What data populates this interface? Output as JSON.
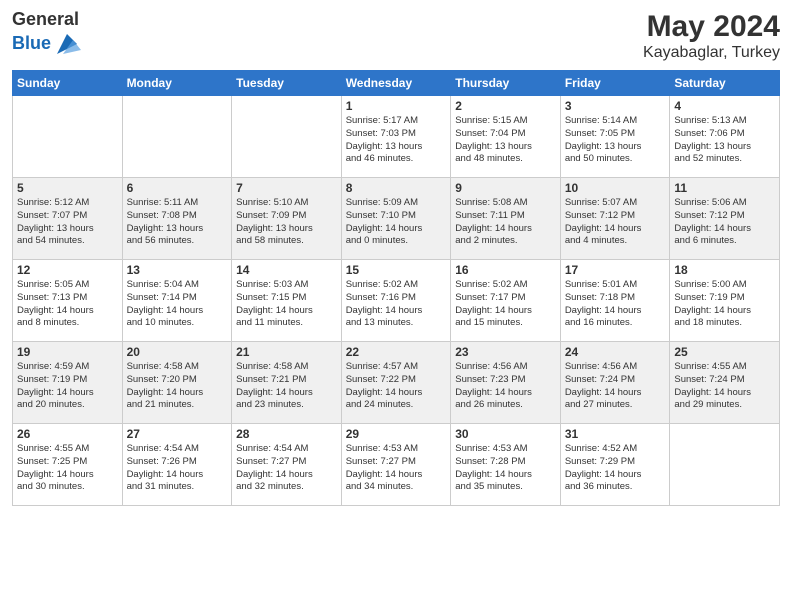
{
  "header": {
    "logo_general": "General",
    "logo_blue": "Blue",
    "month_year": "May 2024",
    "location": "Kayabaglar, Turkey"
  },
  "weekdays": [
    "Sunday",
    "Monday",
    "Tuesday",
    "Wednesday",
    "Thursday",
    "Friday",
    "Saturday"
  ],
  "weeks": [
    [
      {
        "day": "",
        "info": ""
      },
      {
        "day": "",
        "info": ""
      },
      {
        "day": "",
        "info": ""
      },
      {
        "day": "1",
        "info": "Sunrise: 5:17 AM\nSunset: 7:03 PM\nDaylight: 13 hours\nand 46 minutes."
      },
      {
        "day": "2",
        "info": "Sunrise: 5:15 AM\nSunset: 7:04 PM\nDaylight: 13 hours\nand 48 minutes."
      },
      {
        "day": "3",
        "info": "Sunrise: 5:14 AM\nSunset: 7:05 PM\nDaylight: 13 hours\nand 50 minutes."
      },
      {
        "day": "4",
        "info": "Sunrise: 5:13 AM\nSunset: 7:06 PM\nDaylight: 13 hours\nand 52 minutes."
      }
    ],
    [
      {
        "day": "5",
        "info": "Sunrise: 5:12 AM\nSunset: 7:07 PM\nDaylight: 13 hours\nand 54 minutes."
      },
      {
        "day": "6",
        "info": "Sunrise: 5:11 AM\nSunset: 7:08 PM\nDaylight: 13 hours\nand 56 minutes."
      },
      {
        "day": "7",
        "info": "Sunrise: 5:10 AM\nSunset: 7:09 PM\nDaylight: 13 hours\nand 58 minutes."
      },
      {
        "day": "8",
        "info": "Sunrise: 5:09 AM\nSunset: 7:10 PM\nDaylight: 14 hours\nand 0 minutes."
      },
      {
        "day": "9",
        "info": "Sunrise: 5:08 AM\nSunset: 7:11 PM\nDaylight: 14 hours\nand 2 minutes."
      },
      {
        "day": "10",
        "info": "Sunrise: 5:07 AM\nSunset: 7:12 PM\nDaylight: 14 hours\nand 4 minutes."
      },
      {
        "day": "11",
        "info": "Sunrise: 5:06 AM\nSunset: 7:12 PM\nDaylight: 14 hours\nand 6 minutes."
      }
    ],
    [
      {
        "day": "12",
        "info": "Sunrise: 5:05 AM\nSunset: 7:13 PM\nDaylight: 14 hours\nand 8 minutes."
      },
      {
        "day": "13",
        "info": "Sunrise: 5:04 AM\nSunset: 7:14 PM\nDaylight: 14 hours\nand 10 minutes."
      },
      {
        "day": "14",
        "info": "Sunrise: 5:03 AM\nSunset: 7:15 PM\nDaylight: 14 hours\nand 11 minutes."
      },
      {
        "day": "15",
        "info": "Sunrise: 5:02 AM\nSunset: 7:16 PM\nDaylight: 14 hours\nand 13 minutes."
      },
      {
        "day": "16",
        "info": "Sunrise: 5:02 AM\nSunset: 7:17 PM\nDaylight: 14 hours\nand 15 minutes."
      },
      {
        "day": "17",
        "info": "Sunrise: 5:01 AM\nSunset: 7:18 PM\nDaylight: 14 hours\nand 16 minutes."
      },
      {
        "day": "18",
        "info": "Sunrise: 5:00 AM\nSunset: 7:19 PM\nDaylight: 14 hours\nand 18 minutes."
      }
    ],
    [
      {
        "day": "19",
        "info": "Sunrise: 4:59 AM\nSunset: 7:19 PM\nDaylight: 14 hours\nand 20 minutes."
      },
      {
        "day": "20",
        "info": "Sunrise: 4:58 AM\nSunset: 7:20 PM\nDaylight: 14 hours\nand 21 minutes."
      },
      {
        "day": "21",
        "info": "Sunrise: 4:58 AM\nSunset: 7:21 PM\nDaylight: 14 hours\nand 23 minutes."
      },
      {
        "day": "22",
        "info": "Sunrise: 4:57 AM\nSunset: 7:22 PM\nDaylight: 14 hours\nand 24 minutes."
      },
      {
        "day": "23",
        "info": "Sunrise: 4:56 AM\nSunset: 7:23 PM\nDaylight: 14 hours\nand 26 minutes."
      },
      {
        "day": "24",
        "info": "Sunrise: 4:56 AM\nSunset: 7:24 PM\nDaylight: 14 hours\nand 27 minutes."
      },
      {
        "day": "25",
        "info": "Sunrise: 4:55 AM\nSunset: 7:24 PM\nDaylight: 14 hours\nand 29 minutes."
      }
    ],
    [
      {
        "day": "26",
        "info": "Sunrise: 4:55 AM\nSunset: 7:25 PM\nDaylight: 14 hours\nand 30 minutes."
      },
      {
        "day": "27",
        "info": "Sunrise: 4:54 AM\nSunset: 7:26 PM\nDaylight: 14 hours\nand 31 minutes."
      },
      {
        "day": "28",
        "info": "Sunrise: 4:54 AM\nSunset: 7:27 PM\nDaylight: 14 hours\nand 32 minutes."
      },
      {
        "day": "29",
        "info": "Sunrise: 4:53 AM\nSunset: 7:27 PM\nDaylight: 14 hours\nand 34 minutes."
      },
      {
        "day": "30",
        "info": "Sunrise: 4:53 AM\nSunset: 7:28 PM\nDaylight: 14 hours\nand 35 minutes."
      },
      {
        "day": "31",
        "info": "Sunrise: 4:52 AM\nSunset: 7:29 PM\nDaylight: 14 hours\nand 36 minutes."
      },
      {
        "day": "",
        "info": ""
      }
    ]
  ]
}
